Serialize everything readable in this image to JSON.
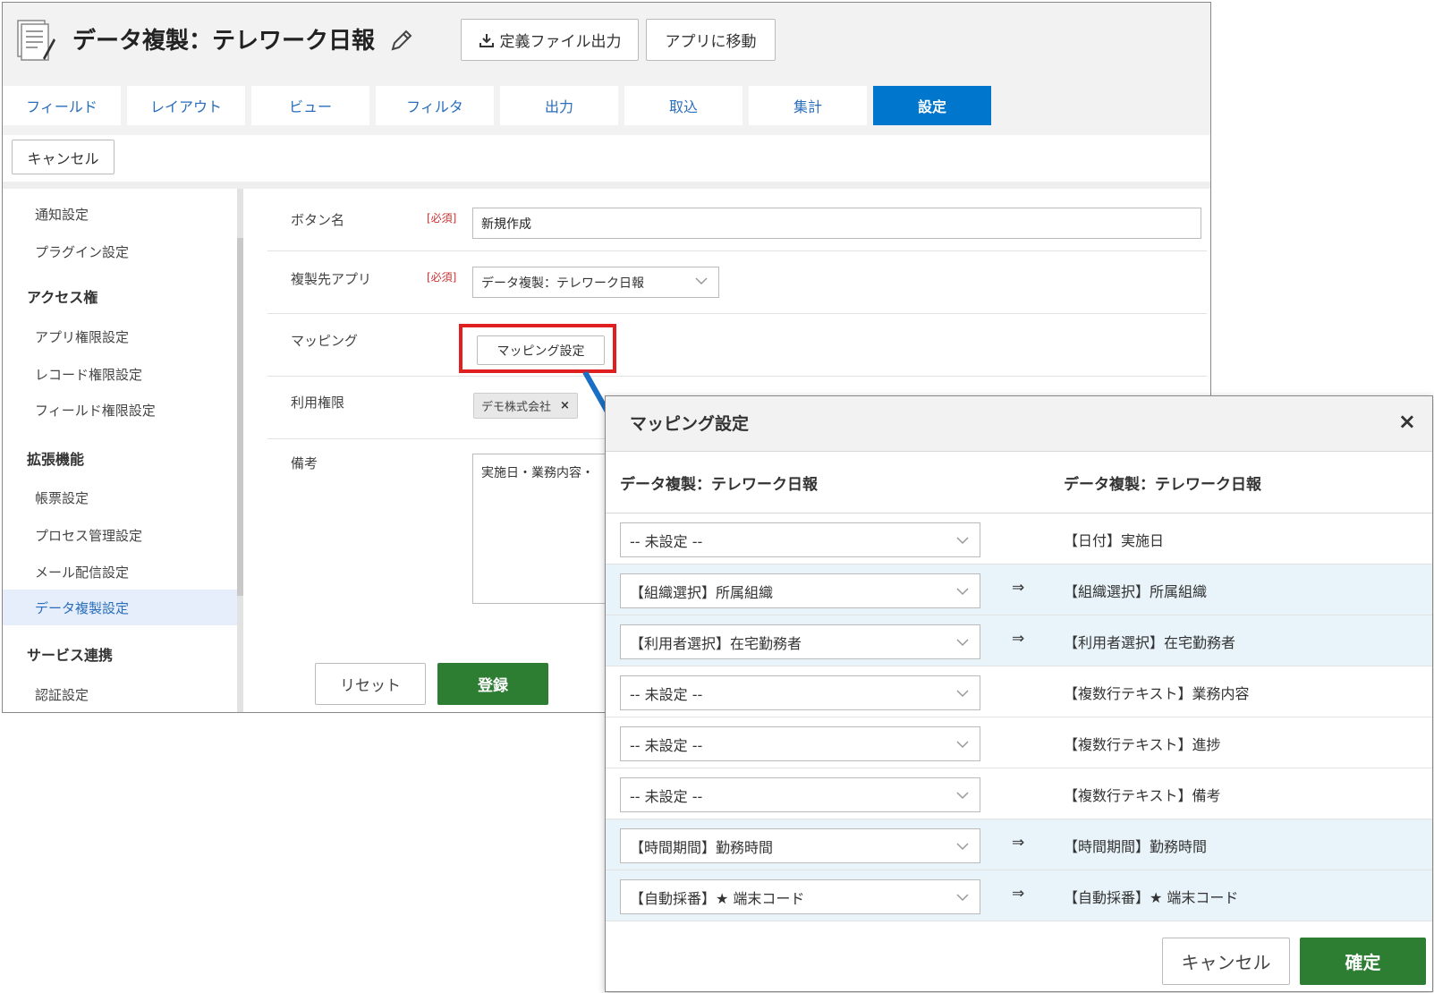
{
  "app": {
    "title": "データ複製：テレワーク日報",
    "export_label": "定義ファイル出力",
    "goto_label": "アプリに移動",
    "tabs": [
      {
        "label": "フィールド"
      },
      {
        "label": "レイアウト"
      },
      {
        "label": "ビュー"
      },
      {
        "label": "フィルタ"
      },
      {
        "label": "出力"
      },
      {
        "label": "取込"
      },
      {
        "label": "集計"
      },
      {
        "label": "設定"
      }
    ],
    "active_tab": "設定",
    "cancel_label": "キャンセル"
  },
  "sidebar": {
    "items": [
      {
        "label": "通知設定",
        "type": "item"
      },
      {
        "label": "プラグイン設定",
        "type": "item"
      },
      {
        "label": "アクセス権",
        "type": "head"
      },
      {
        "label": "アプリ権限設定",
        "type": "item"
      },
      {
        "label": "レコード権限設定",
        "type": "item"
      },
      {
        "label": "フィールド権限設定",
        "type": "item"
      },
      {
        "label": "拡張機能",
        "type": "head"
      },
      {
        "label": "帳票設定",
        "type": "item"
      },
      {
        "label": "プロセス管理設定",
        "type": "item"
      },
      {
        "label": "メール配信設定",
        "type": "item"
      },
      {
        "label": "データ複製設定",
        "type": "item",
        "active": true
      },
      {
        "label": "サービス連携",
        "type": "head"
      },
      {
        "label": "認証設定",
        "type": "item"
      }
    ]
  },
  "form": {
    "button_name_label": "ボタン名",
    "required": "[必須]",
    "button_name_value": "新規作成",
    "target_app_label": "複製先アプリ",
    "target_app_value": "データ複製：テレワーク日報",
    "mapping_label": "マッピング",
    "mapping_button": "マッピング設定",
    "permission_label": "利用権限",
    "permission_tag": "デモ株式会社",
    "permission_tag_remove": "×",
    "remarks_label": "備考",
    "remarks_value": "実施日・業務内容・",
    "reset_label": "リセット",
    "register_label": "登録"
  },
  "dialog": {
    "title": "マッピング設定",
    "close": "×",
    "source_header": "データ複製：テレワーク日報",
    "target_header": "データ複製：テレワーク日報",
    "rows": [
      {
        "source": "-- 未設定 --",
        "arrow": "",
        "target": "【日付】実施日",
        "mapped": false
      },
      {
        "source": "【組織選択】所属組織",
        "arrow": "⇒",
        "target": "【組織選択】所属組織",
        "mapped": true
      },
      {
        "source": "【利用者選択】在宅勤務者",
        "arrow": "⇒",
        "target": "【利用者選択】在宅勤務者",
        "mapped": true
      },
      {
        "source": "-- 未設定 --",
        "arrow": "",
        "target": "【複数行テキスト】業務内容",
        "mapped": false
      },
      {
        "source": "-- 未設定 --",
        "arrow": "",
        "target": "【複数行テキスト】進捗",
        "mapped": false
      },
      {
        "source": "-- 未設定 --",
        "arrow": "",
        "target": "【複数行テキスト】備考",
        "mapped": false
      },
      {
        "source": "【時間期間】勤務時間",
        "arrow": "⇒",
        "target": "【時間期間】勤務時間",
        "mapped": true
      },
      {
        "source": "【自動採番】★ 端末コード",
        "arrow": "⇒",
        "target": "【自動採番】★ 端末コード",
        "mapped": true
      }
    ],
    "cancel_label": "キャンセル",
    "ok_label": "確定"
  },
  "colors": {
    "accent": "#0077cc",
    "confirm": "#2d7d32",
    "highlight": "#e02020",
    "mapped_row": "#e8f3fa"
  }
}
